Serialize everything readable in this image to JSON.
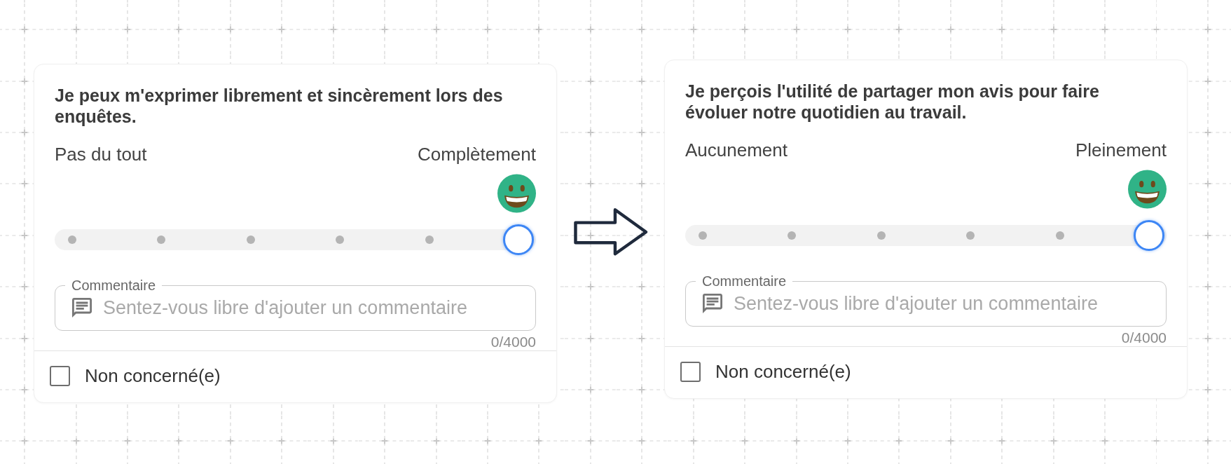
{
  "questions": [
    {
      "title": "Je peux m'exprimer librement et sincèrement lors des enquêtes.",
      "scale": {
        "min_label": "Pas du tout",
        "max_label": "Complètement",
        "level": 1
      },
      "comment": {
        "label": "Commentaire",
        "placeholder": "Sentez-vous libre d'ajouter un commentaire",
        "counter": "0/4000"
      },
      "not_concerned": {
        "label": "Non concerné(e)",
        "checked": false
      }
    },
    {
      "title": "Je perçois l'utilité de partager mon avis pour faire évoluer notre quotidien au travail.",
      "scale": {
        "min_label": "Aucunement",
        "max_label": "Pleinement",
        "level": 1
      },
      "comment": {
        "label": "Commentaire",
        "placeholder": "Sentez-vous libre d'ajouter un commentaire",
        "counter": "0/4000"
      },
      "not_concerned": {
        "label": "Non concerné(e)",
        "checked": false
      }
    }
  ]
}
